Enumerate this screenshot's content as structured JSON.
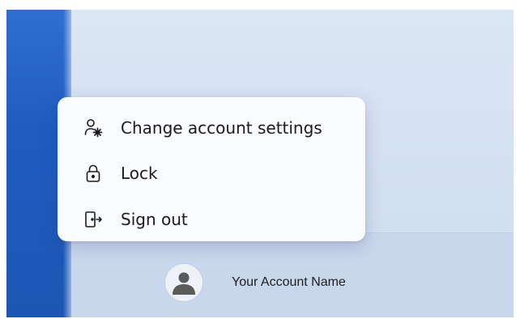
{
  "context_menu": {
    "items": [
      {
        "label": "Change account settings",
        "icon": "account-settings-icon"
      },
      {
        "label": "Lock",
        "icon": "lock-icon"
      },
      {
        "label": "Sign out",
        "icon": "sign-out-icon"
      }
    ]
  },
  "account": {
    "name": "Your Account Name",
    "avatar_icon": "user-avatar-icon"
  },
  "colors": {
    "wallpaper_blue": "#1f5cc0",
    "menu_background": "#f9fbfe",
    "start_panel": "#d4e1f2"
  }
}
